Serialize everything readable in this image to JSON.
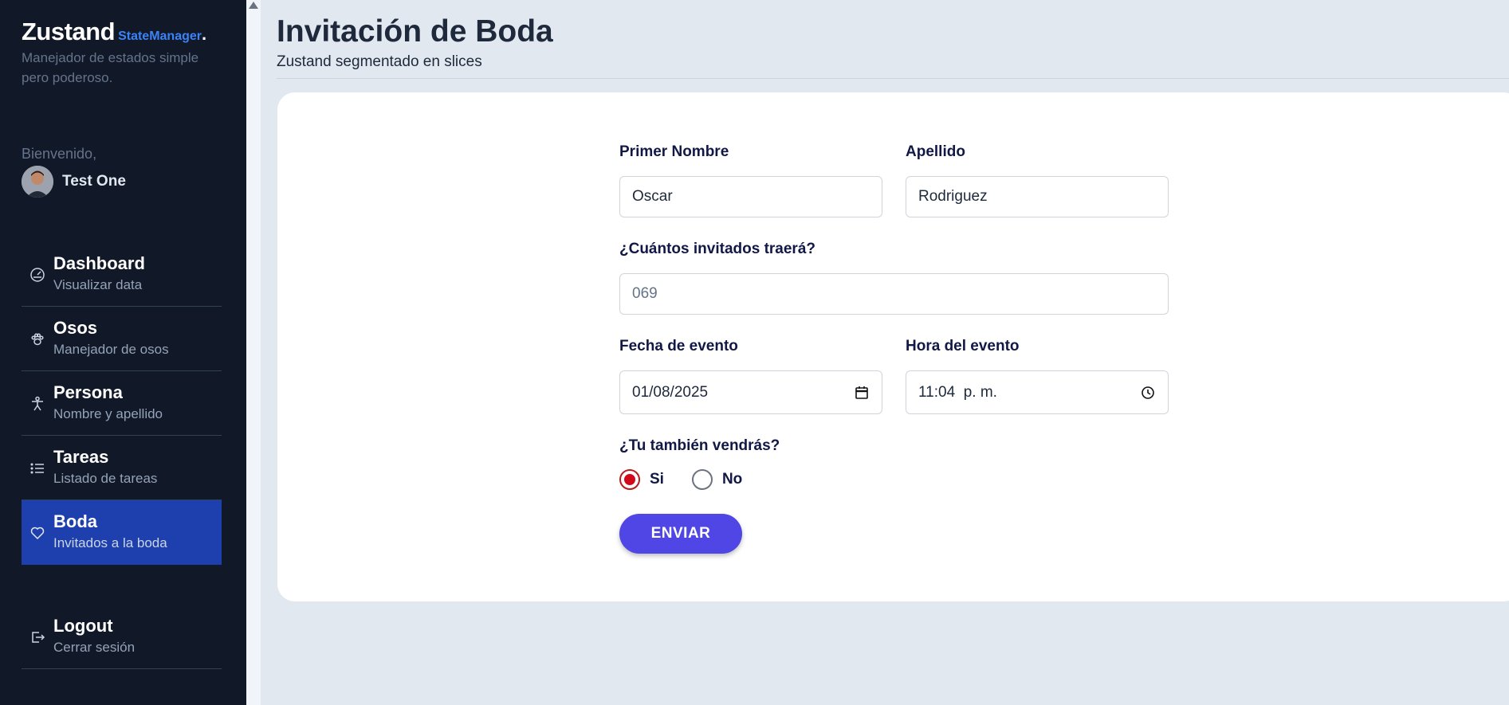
{
  "sidebar": {
    "brand": {
      "name": "Zustand",
      "sub": "StateManager",
      "dot": "."
    },
    "tagline": "Manejador de estados simple pero poderoso.",
    "welcome": "Bienvenido,",
    "user_name": "Test One",
    "items": [
      {
        "title": "Dashboard",
        "subtitle": "Visualizar data",
        "icon": "gauge-icon",
        "active": false
      },
      {
        "title": "Osos",
        "subtitle": "Manejador de osos",
        "icon": "paw-icon",
        "active": false
      },
      {
        "title": "Persona",
        "subtitle": "Nombre y apellido",
        "icon": "person-icon",
        "active": false
      },
      {
        "title": "Tareas",
        "subtitle": "Listado de tareas",
        "icon": "list-icon",
        "active": false
      },
      {
        "title": "Boda",
        "subtitle": "Invitados a la boda",
        "icon": "heart-icon",
        "active": true
      }
    ],
    "logout": {
      "title": "Logout",
      "subtitle": "Cerrar sesión",
      "icon": "logout-icon"
    }
  },
  "header": {
    "title": "Invitación de Boda",
    "subtitle": "Zustand segmentado en slices"
  },
  "form": {
    "first_name": {
      "label": "Primer Nombre",
      "value": "Oscar"
    },
    "last_name": {
      "label": "Apellido",
      "value": "Rodriguez"
    },
    "guests": {
      "label": "¿Cuántos invitados traerá?",
      "value": "069"
    },
    "event_date": {
      "label": "Fecha de evento",
      "value": "01/08/2025",
      "icon": "calendar-icon"
    },
    "event_time": {
      "label": "Hora del evento",
      "value": "11:04  p. m.",
      "icon": "clock-icon"
    },
    "attending": {
      "label": "¿Tu también vendrás?",
      "options": [
        {
          "label": "Si",
          "checked": true
        },
        {
          "label": "No",
          "checked": false
        }
      ]
    },
    "submit_label": "ENVIAR"
  },
  "colors": {
    "sidebar_bg": "#111827",
    "active_item": "#1e40af",
    "brand_accent": "#3b82f6",
    "button": "#4f46e5",
    "radio_checked": "#d10a1a",
    "page_bg": "#e2e8f0"
  }
}
